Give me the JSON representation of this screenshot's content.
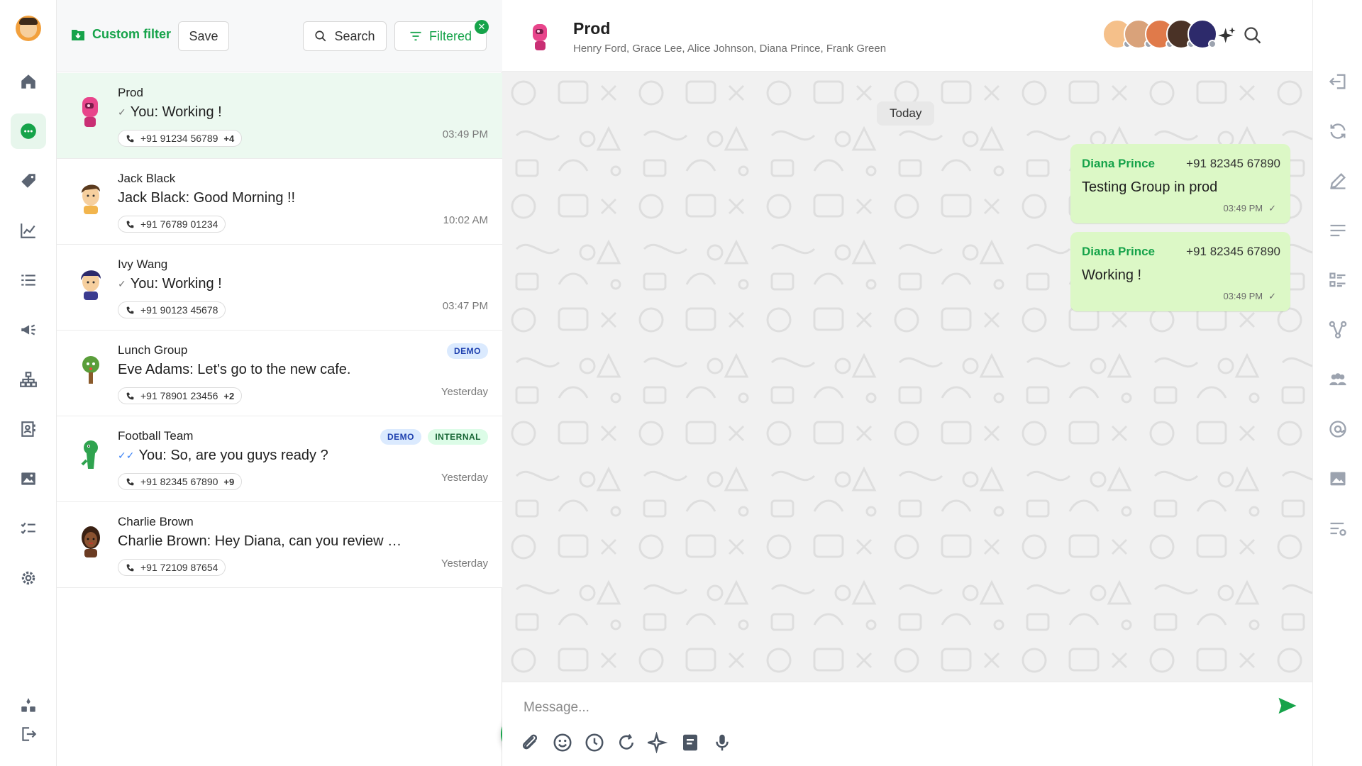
{
  "toolbar": {
    "custom_filter_label": "Custom filter",
    "save_label": "Save",
    "search_label": "Search",
    "filtered_label": "Filtered"
  },
  "chats": [
    {
      "name": "Prod",
      "tick": "single",
      "preview": "You: Working !",
      "phone": "+91 91234 56789",
      "more": "+4",
      "time": "03:49 PM",
      "tags": [],
      "selected": true,
      "avatar_color": "#e8458b"
    },
    {
      "name": "Jack Black",
      "tick": "",
      "preview": "Jack Black: Good Morning !!",
      "phone": "+91 76789 01234",
      "more": "",
      "time": "10:02 AM",
      "tags": [],
      "selected": false,
      "avatar_color": "#f2b54d"
    },
    {
      "name": "Ivy Wang",
      "tick": "single",
      "preview": "You: Working !",
      "phone": "+91 90123 45678",
      "more": "",
      "time": "03:47 PM",
      "tags": [],
      "selected": false,
      "avatar_color": "#3b3b8f"
    },
    {
      "name": "Lunch Group",
      "tick": "",
      "preview": "Eve Adams: Let's go to the new cafe.",
      "phone": "+91 78901 23456",
      "more": "+2",
      "time": "Yesterday",
      "tags": [
        "DEMO"
      ],
      "selected": false,
      "avatar_color": "#5a9e3a"
    },
    {
      "name": "Football Team",
      "tick": "double",
      "preview": "You: So, are you guys ready ?",
      "phone": "+91 82345 67890",
      "more": "+9",
      "time": "Yesterday",
      "tags": [
        "DEMO",
        "INTERNAL"
      ],
      "selected": false,
      "avatar_color": "#2fa34f"
    },
    {
      "name": "Charlie Brown",
      "tick": "",
      "preview": "Charlie Brown: Hey Diana, can you review …",
      "phone": "+91 72109 87654",
      "more": "",
      "time": "Yesterday",
      "tags": [],
      "selected": false,
      "avatar_color": "#6b3b22"
    }
  ],
  "conversation": {
    "title": "Prod",
    "members": "Henry Ford, Grace Lee, Alice Johnson, Diana Prince, Frank Green",
    "member_avatars": [
      "#f5c08a",
      "#d9a27a",
      "#e07a4a",
      "#4a3226",
      "#2d2a6b"
    ],
    "date_divider": "Today",
    "messages": [
      {
        "sender": "Diana Prince",
        "phone": "+91 82345 67890",
        "text": "Testing Group in prod",
        "time": "03:49 PM"
      },
      {
        "sender": "Diana Prince",
        "phone": "+91 82345 67890",
        "text": "Working !",
        "time": "03:49 PM"
      }
    ],
    "composer_placeholder": "Message..."
  },
  "colors": {
    "accent": "#16a34a",
    "bubble": "#dcf8c6",
    "selected_row": "#ecf9f0"
  }
}
